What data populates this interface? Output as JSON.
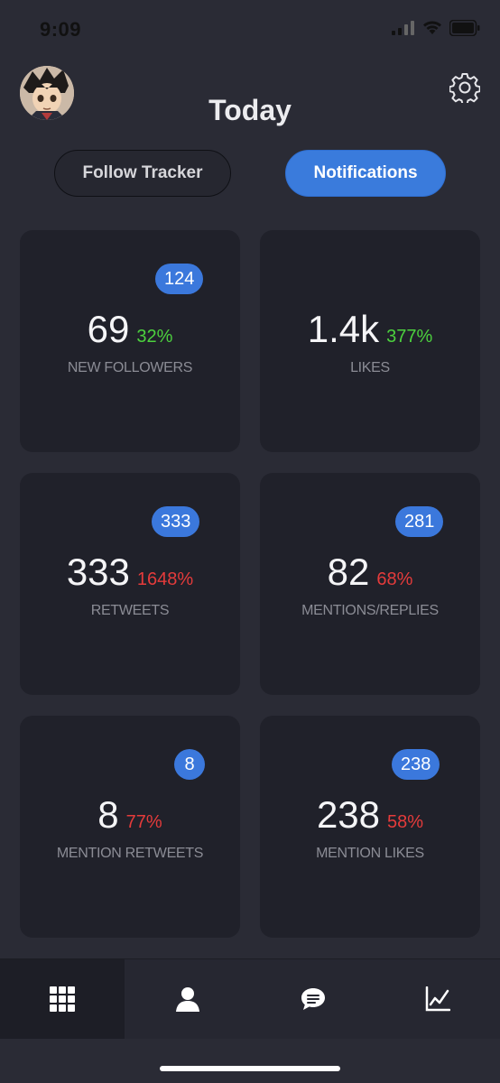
{
  "status": {
    "time": "9:09"
  },
  "header": {
    "title": "Today"
  },
  "segments": {
    "follow_tracker": "Follow Tracker",
    "notifications": "Notifications",
    "selected": "Notifications"
  },
  "cards": [
    {
      "badge": "124",
      "value": "69",
      "pct": "32%",
      "trend_color": "#4cd13e",
      "label": "NEW FOLLOWERS"
    },
    {
      "badge": "",
      "value": "1.4k",
      "pct": "377%",
      "trend_color": "#4cd13e",
      "label": "LIKES"
    },
    {
      "badge": "333",
      "value": "333",
      "pct": "1648%",
      "trend_color": "#e53b3b",
      "label": "RETWEETS"
    },
    {
      "badge": "281",
      "value": "82",
      "pct": "68%",
      "trend_color": "#e53b3b",
      "label": "MENTIONS/REPLIES"
    },
    {
      "badge": "8",
      "value": "8",
      "pct": "77%",
      "trend_color": "#e53b3b",
      "label": "MENTION RETWEETS"
    },
    {
      "badge": "238",
      "value": "238",
      "pct": "58%",
      "trend_color": "#e53b3b",
      "label": "MENTION LIKES"
    }
  ],
  "tabbar": {
    "items": [
      {
        "icon": "grid-icon",
        "active": true
      },
      {
        "icon": "person-icon",
        "active": false
      },
      {
        "icon": "chat-bubble-icon",
        "active": false
      },
      {
        "icon": "line-chart-icon",
        "active": false
      }
    ]
  }
}
